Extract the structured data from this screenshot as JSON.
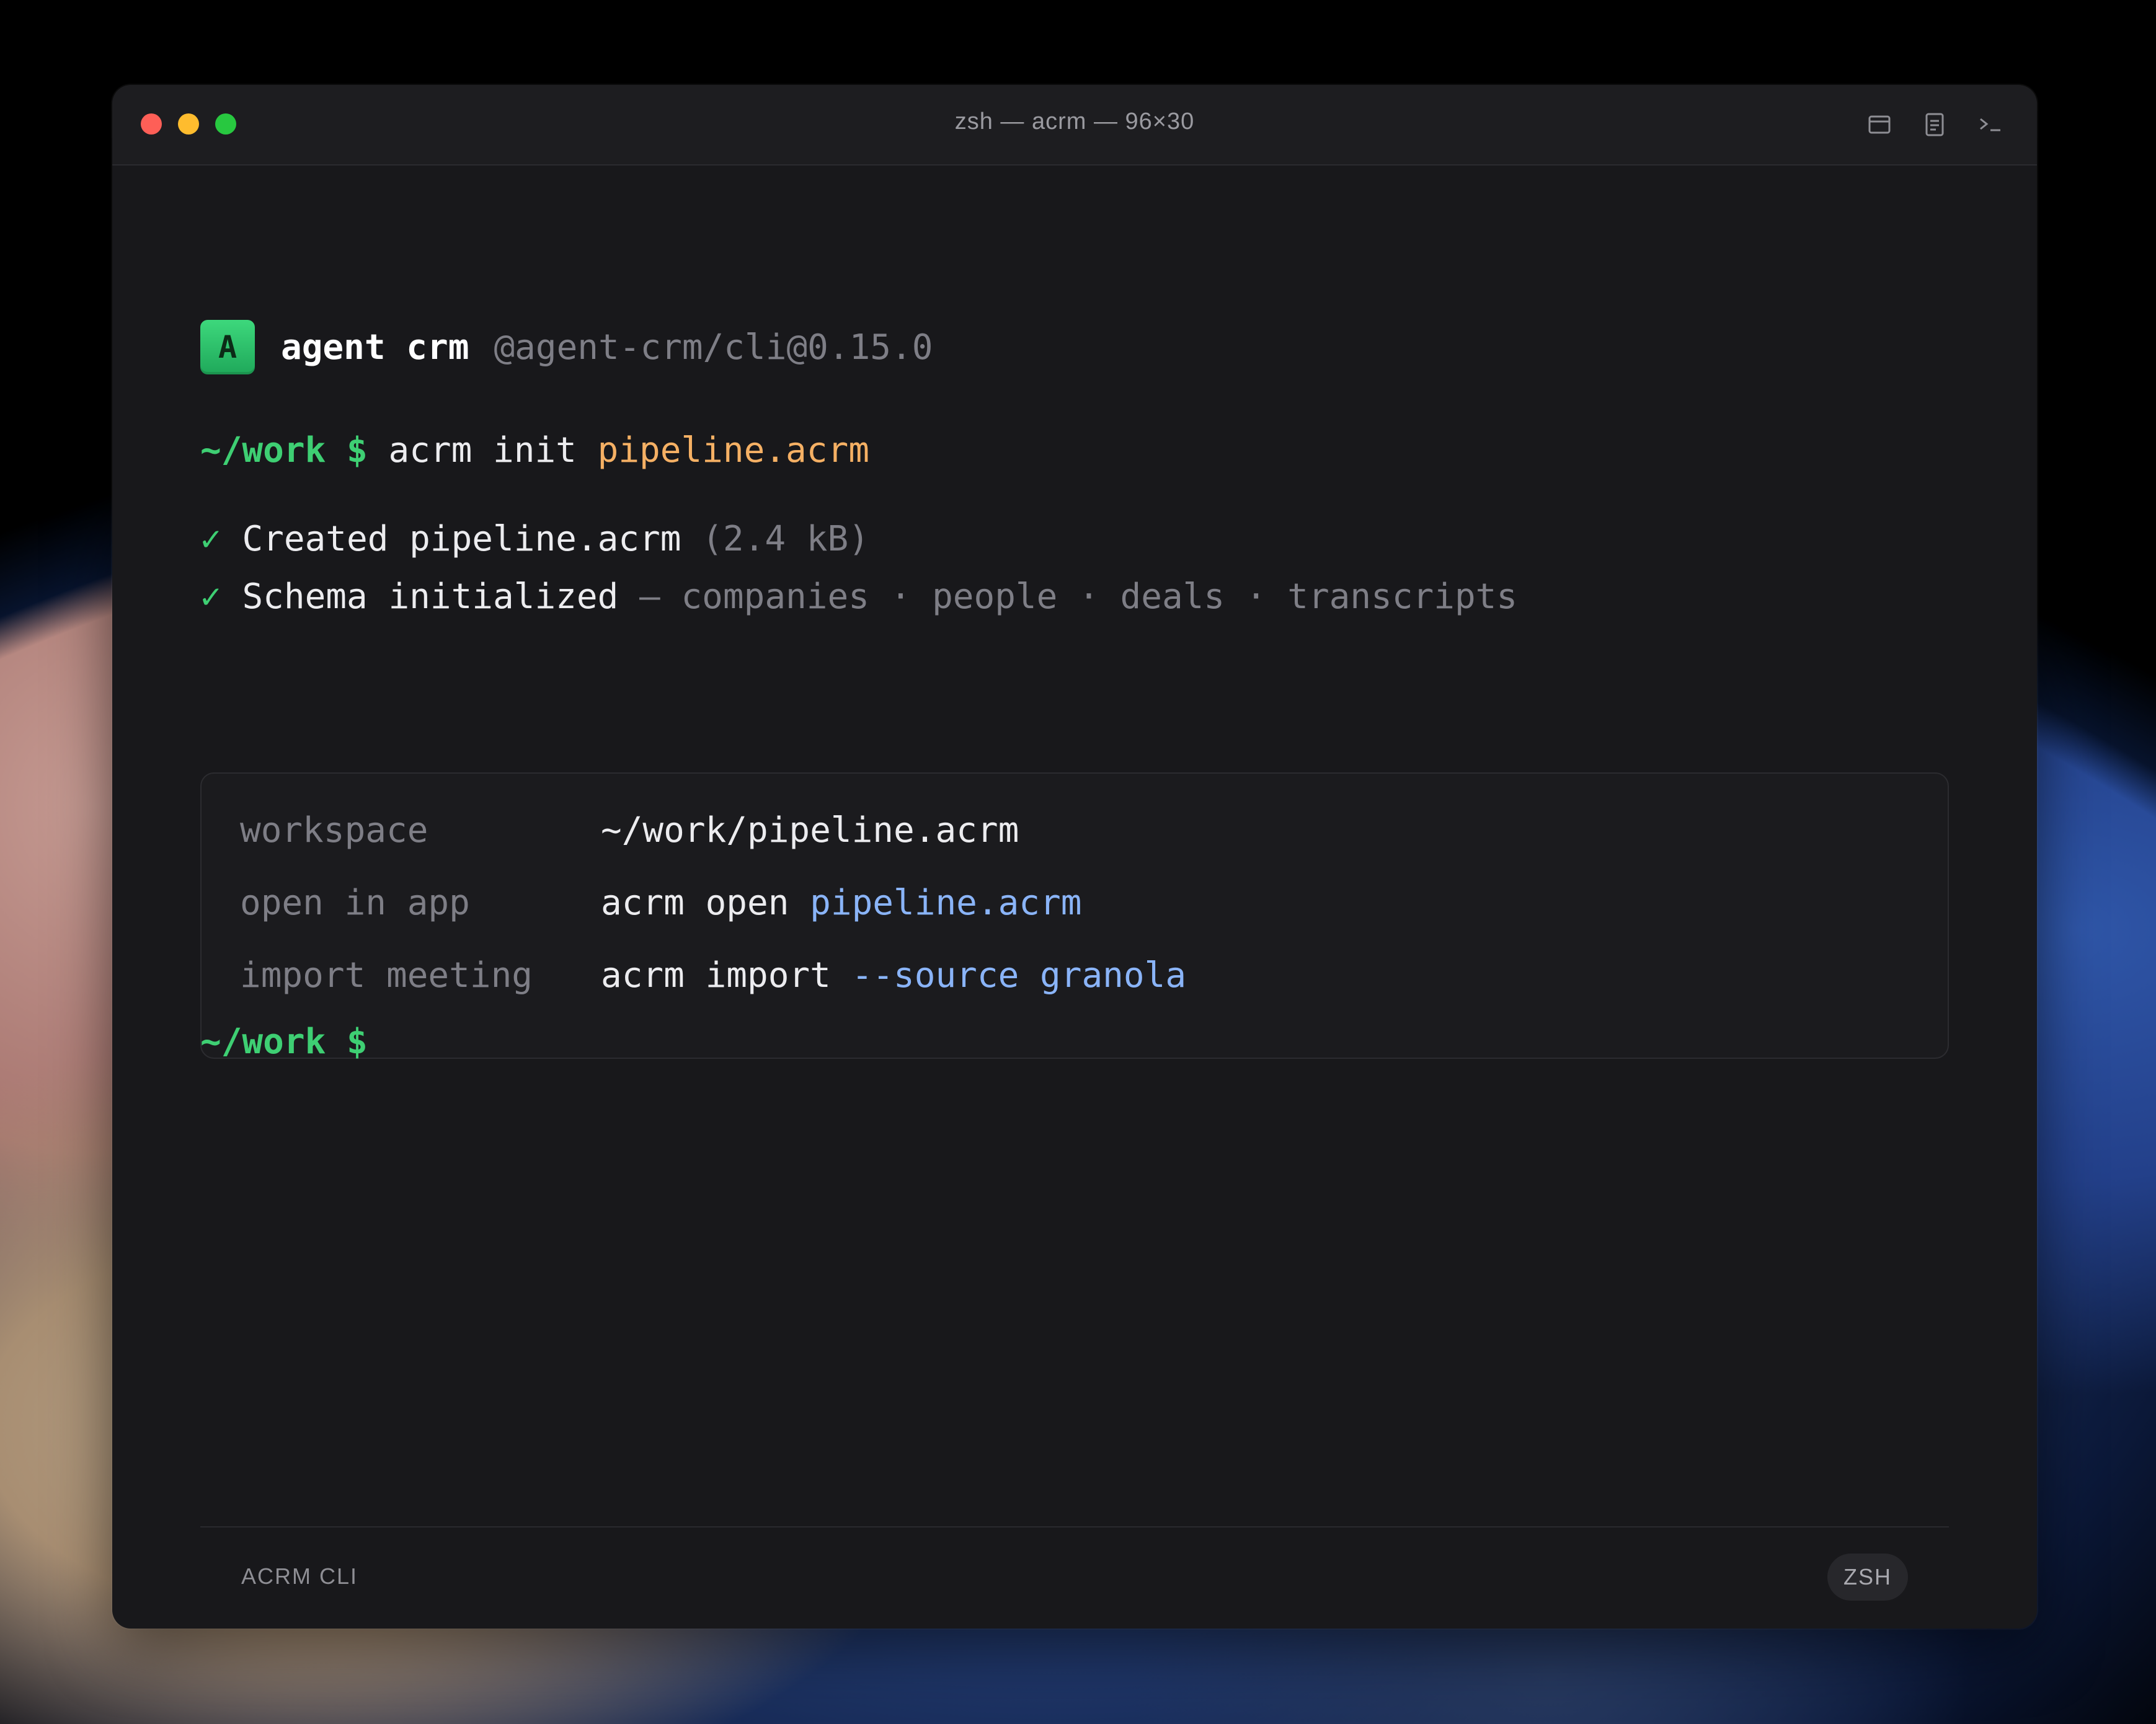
{
  "window": {
    "title": "zsh — acrm — 96×30"
  },
  "toolbar": {
    "icons": [
      "window-icon",
      "document-icon",
      "terminal-icon"
    ]
  },
  "brand": {
    "logo_letter": "A",
    "name": "agent crm",
    "package": "@agent-crm/cli@0.15.0"
  },
  "session": {
    "prompt_path": "~/work",
    "prompt_symbol": "$",
    "command": "acrm init",
    "command_arg": "pipeline.acrm",
    "check_glyph": "✓",
    "created_label": "Created pipeline.acrm",
    "created_size": "(2.4 kB)",
    "schema_label": "Schema initialized",
    "schema_sep": "—",
    "schema_tables": [
      "companies",
      "people",
      "deals",
      "transcripts"
    ],
    "schema_dot": "·"
  },
  "info": {
    "rows": [
      {
        "key": "workspace",
        "cmd": "~/work/pipeline.acrm",
        "arg": ""
      },
      {
        "key": "open in app",
        "cmd": "acrm open",
        "arg": "pipeline.acrm"
      },
      {
        "key": "import meeting",
        "cmd": "acrm import",
        "arg": "--source granola"
      }
    ]
  },
  "footer": {
    "left": "ACRM CLI",
    "badge": "ZSH"
  },
  "colors": {
    "background": "#18181b",
    "prompt_green": "#3ecf73",
    "arg_orange": "#f5b064",
    "link_blue": "#8ab4f8",
    "dim_gray": "#7e7e86"
  }
}
